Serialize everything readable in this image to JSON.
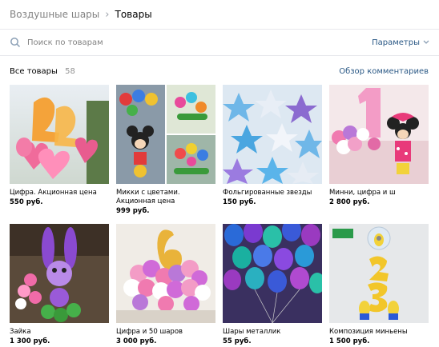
{
  "breadcrumb": {
    "root": "Воздушные шары",
    "current": "Товары"
  },
  "search": {
    "placeholder": "Поиск по товарам",
    "params_label": "Параметры"
  },
  "list": {
    "title": "Все товары",
    "count": "58",
    "comments_link": "Обзор комментариев"
  },
  "products": [
    {
      "title": "Цифра. Акционная цена",
      "price": "550 руб."
    },
    {
      "title": "Микки с цветами. Акционная цена",
      "price": "999 руб."
    },
    {
      "title": "Фольгированные звезды",
      "price": "150 руб."
    },
    {
      "title": "Минни, цифра и ш",
      "price": "2 800 руб."
    },
    {
      "title": "Зайка",
      "price": "1 300 руб."
    },
    {
      "title": "Цифра и 50 шаров",
      "price": "3 000 руб."
    },
    {
      "title": "Шары металлик",
      "price": "55 руб."
    },
    {
      "title": "Композиция миньены",
      "price": "1 500 руб."
    }
  ]
}
